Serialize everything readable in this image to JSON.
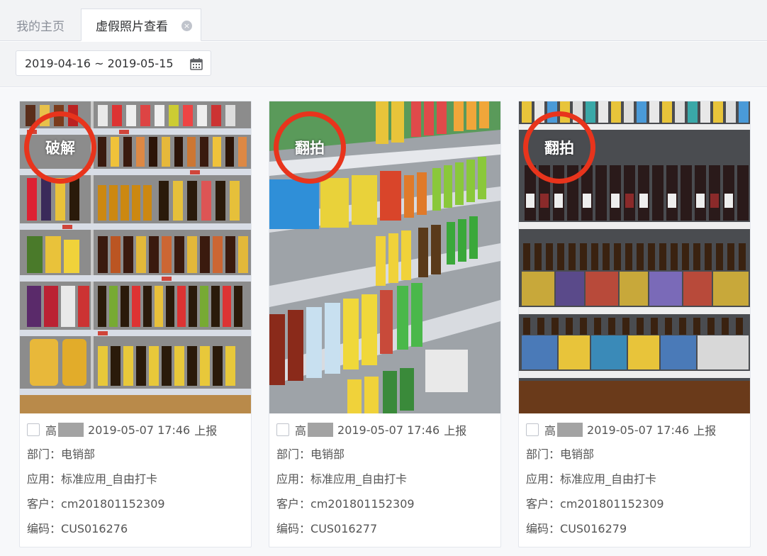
{
  "tabs": [
    {
      "label": "我的主页",
      "active": false
    },
    {
      "label": "虚假照片查看",
      "active": true,
      "closable": true
    }
  ],
  "filter": {
    "date_range": "2019-04-16 ~ 2019-05-15",
    "icon": "calendar-icon"
  },
  "cards": [
    {
      "badge": "破解",
      "name": "高",
      "time": "2019-05-07 17:46",
      "action": "上报",
      "dept_label": "部门：",
      "dept": "电销部",
      "app_label": "应用：",
      "app": "标准应用_自由打卡",
      "customer_label": "客户：",
      "customer": "cm201801152309",
      "code_label": "编码：",
      "code": "CUS016276"
    },
    {
      "badge": "翻拍",
      "name": "高",
      "time": "2019-05-07 17:46",
      "action": "上报",
      "dept_label": "部门：",
      "dept": "电销部",
      "app_label": "应用：",
      "app": "标准应用_自由打卡",
      "customer_label": "客户：",
      "customer": "cm201801152309",
      "code_label": "编码：",
      "code": "CUS016277"
    },
    {
      "badge": "翻拍",
      "name": "高",
      "time": "2019-05-07 17:46",
      "action": "上报",
      "dept_label": "部门：",
      "dept": "电销部",
      "app_label": "应用：",
      "app": "标准应用_自由打卡",
      "customer_label": "客户：",
      "customer": "cm201801152309",
      "code_label": "编码：",
      "code": "CUS016279"
    }
  ],
  "colors": {
    "badge_ring": "#e8341c",
    "tabbar_bg": "#f2f3f5"
  }
}
